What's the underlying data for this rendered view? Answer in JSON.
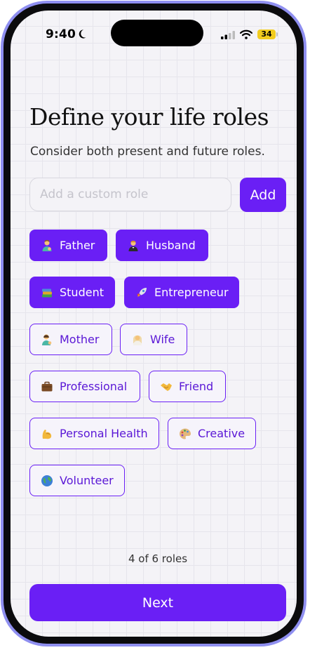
{
  "status_bar": {
    "time": "9:40",
    "battery": "34"
  },
  "header": {
    "title": "Define your life roles",
    "subtitle": "Consider both present and future roles."
  },
  "custom_role": {
    "placeholder": "Add a custom role",
    "value": "",
    "add_label": "Add"
  },
  "roles": [
    {
      "label": "Father",
      "icon": "father-emoji-icon",
      "selected": true
    },
    {
      "label": "Husband",
      "icon": "husband-emoji-icon",
      "selected": true
    },
    {
      "label": "Student",
      "icon": "books-emoji-icon",
      "selected": true
    },
    {
      "label": "Entrepreneur",
      "icon": "rocket-emoji-icon",
      "selected": true
    },
    {
      "label": "Mother",
      "icon": "mother-emoji-icon",
      "selected": false
    },
    {
      "label": "Wife",
      "icon": "wife-emoji-icon",
      "selected": false
    },
    {
      "label": "Professional",
      "icon": "briefcase-emoji-icon",
      "selected": false
    },
    {
      "label": "Friend",
      "icon": "handshake-emoji-icon",
      "selected": false
    },
    {
      "label": "Personal Health",
      "icon": "flexed-biceps-emoji-icon",
      "selected": false
    },
    {
      "label": "Creative",
      "icon": "palette-emoji-icon",
      "selected": false
    },
    {
      "label": "Volunteer",
      "icon": "globe-emoji-icon",
      "selected": false
    }
  ],
  "footer": {
    "count_text": "4 of 6 roles",
    "next_label": "Next"
  },
  "colors": {
    "accent": "#6a1ff5",
    "frame": "#8f8ff0",
    "background": "#f4f3f7"
  }
}
